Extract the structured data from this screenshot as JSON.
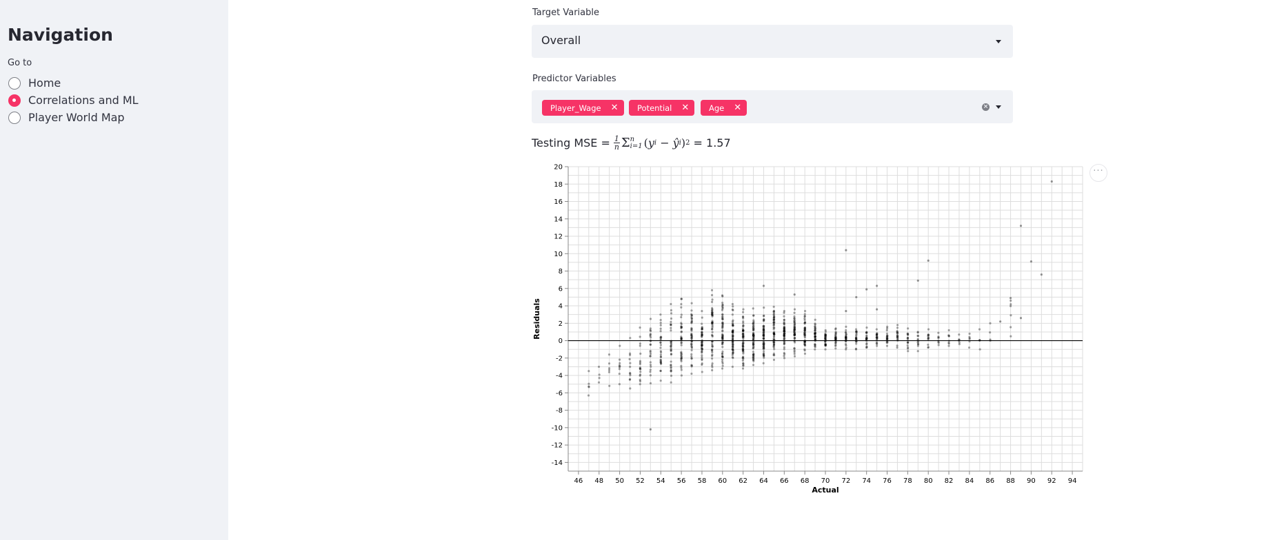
{
  "sidebar": {
    "title": "Navigation",
    "goto_label": "Go to",
    "options": [
      {
        "label": "Home",
        "selected": false
      },
      {
        "label": "Correlations and ML",
        "selected": true
      },
      {
        "label": "Player World Map",
        "selected": false
      }
    ]
  },
  "target": {
    "label": "Target Variable",
    "value": "Overall"
  },
  "predictors": {
    "label": "Predictor Variables",
    "tags": [
      "Player_Wage",
      "Potential",
      "Age"
    ]
  },
  "mse": {
    "prefix": "Testing MSE =",
    "value_text": "= 1.57"
  },
  "colors": {
    "accent": "#f63366",
    "sidebar_bg": "#f0f2f6"
  },
  "chart_data": {
    "type": "scatter",
    "xlabel": "Actual",
    "ylabel": "Residuals",
    "xlim": [
      45,
      95
    ],
    "ylim": [
      -15,
      20
    ],
    "x_ticks": [
      46,
      48,
      50,
      52,
      54,
      56,
      58,
      60,
      62,
      64,
      66,
      68,
      70,
      72,
      74,
      76,
      78,
      80,
      82,
      84,
      86,
      88,
      90,
      92,
      94
    ],
    "y_ticks": [
      -14,
      -12,
      -10,
      -8,
      -6,
      -4,
      -2,
      0,
      2,
      4,
      6,
      8,
      10,
      12,
      14,
      16,
      18,
      20
    ],
    "grid": true,
    "zero_rule": 0,
    "columns": [
      {
        "x": 47,
        "lo": -6.3,
        "hi": -3.5,
        "n": 5
      },
      {
        "x": 48,
        "lo": -4.8,
        "hi": -3.0,
        "n": 4
      },
      {
        "x": 49,
        "lo": -5.2,
        "hi": -1.6,
        "n": 6
      },
      {
        "x": 50,
        "lo": -5.0,
        "hi": -0.6,
        "n": 9
      },
      {
        "x": 51,
        "lo": -5.5,
        "hi": 0.3,
        "n": 12
      },
      {
        "x": 52,
        "lo": -5.0,
        "hi": 1.5,
        "n": 18
      },
      {
        "x": 53,
        "lo": -4.9,
        "hi": 2.5,
        "n": 24
      },
      {
        "x": 54,
        "lo": -4.6,
        "hi": 3.0,
        "n": 30
      },
      {
        "x": 55,
        "lo": -4.8,
        "hi": 4.2,
        "n": 34
      },
      {
        "x": 56,
        "lo": -4.0,
        "hi": 4.8,
        "n": 40
      },
      {
        "x": 57,
        "lo": -3.8,
        "hi": 4.3,
        "n": 44
      },
      {
        "x": 58,
        "lo": -3.6,
        "hi": 3.4,
        "n": 48
      },
      {
        "x": 59,
        "lo": -3.4,
        "hi": 5.8,
        "n": 52
      },
      {
        "x": 60,
        "lo": -3.2,
        "hi": 5.2,
        "n": 56
      },
      {
        "x": 61,
        "lo": -3.0,
        "hi": 4.2,
        "n": 58
      },
      {
        "x": 62,
        "lo": -3.2,
        "hi": 3.6,
        "n": 60
      },
      {
        "x": 63,
        "lo": -2.8,
        "hi": 3.7,
        "n": 60
      },
      {
        "x": 64,
        "lo": -2.6,
        "hi": 3.8,
        "n": 60
      },
      {
        "x": 65,
        "lo": -2.2,
        "hi": 3.9,
        "n": 56
      },
      {
        "x": 66,
        "lo": -2.0,
        "hi": 3.4,
        "n": 52
      },
      {
        "x": 67,
        "lo": -1.8,
        "hi": 3.6,
        "n": 48
      },
      {
        "x": 68,
        "lo": -1.5,
        "hi": 3.4,
        "n": 46
      },
      {
        "x": 69,
        "lo": -1.0,
        "hi": 2.4,
        "n": 40
      },
      {
        "x": 70,
        "lo": -1.0,
        "hi": 1.2,
        "n": 32
      },
      {
        "x": 71,
        "lo": -0.9,
        "hi": 1.4,
        "n": 28
      },
      {
        "x": 72,
        "lo": -1.0,
        "hi": 1.6,
        "n": 26
      },
      {
        "x": 73,
        "lo": -1.0,
        "hi": 1.3,
        "n": 22
      },
      {
        "x": 74,
        "lo": -0.8,
        "hi": 1.5,
        "n": 22
      },
      {
        "x": 75,
        "lo": -0.6,
        "hi": 1.3,
        "n": 20
      },
      {
        "x": 76,
        "lo": -0.6,
        "hi": 1.6,
        "n": 20
      },
      {
        "x": 77,
        "lo": -0.8,
        "hi": 1.8,
        "n": 18
      },
      {
        "x": 78,
        "lo": -1.2,
        "hi": 1.4,
        "n": 16
      },
      {
        "x": 79,
        "lo": -1.2,
        "hi": 1.0,
        "n": 12
      },
      {
        "x": 80,
        "lo": -0.8,
        "hi": 1.3,
        "n": 12
      },
      {
        "x": 81,
        "lo": -0.5,
        "hi": 0.9,
        "n": 8
      },
      {
        "x": 82,
        "lo": -0.6,
        "hi": 1.2,
        "n": 8
      },
      {
        "x": 83,
        "lo": -0.4,
        "hi": 0.7,
        "n": 6
      },
      {
        "x": 84,
        "lo": -0.8,
        "hi": 0.8,
        "n": 6
      },
      {
        "x": 85,
        "lo": -1.0,
        "hi": 1.3,
        "n": 5
      },
      {
        "x": 86,
        "lo": 0.0,
        "hi": 2.0,
        "n": 4
      },
      {
        "x": 88,
        "lo": 0.5,
        "hi": 4.6,
        "n": 6
      }
    ],
    "outliers": [
      {
        "x": 53,
        "y": -10.2
      },
      {
        "x": 72,
        "y": 10.4
      },
      {
        "x": 72,
        "y": 3.4
      },
      {
        "x": 73,
        "y": 5.0
      },
      {
        "x": 74,
        "y": 5.9
      },
      {
        "x": 75,
        "y": 6.3
      },
      {
        "x": 75,
        "y": 3.6
      },
      {
        "x": 79,
        "y": 6.9
      },
      {
        "x": 80,
        "y": 9.2
      },
      {
        "x": 89,
        "y": 13.2
      },
      {
        "x": 89,
        "y": 2.6
      },
      {
        "x": 90,
        "y": 9.1
      },
      {
        "x": 91,
        "y": 7.6
      },
      {
        "x": 92,
        "y": 18.3
      },
      {
        "x": 87,
        "y": 2.2
      },
      {
        "x": 64,
        "y": 6.3
      },
      {
        "x": 67,
        "y": 5.3
      },
      {
        "x": 60,
        "y": 5.1
      },
      {
        "x": 56,
        "y": 4.8
      },
      {
        "x": 88,
        "y": 4.9
      }
    ]
  }
}
